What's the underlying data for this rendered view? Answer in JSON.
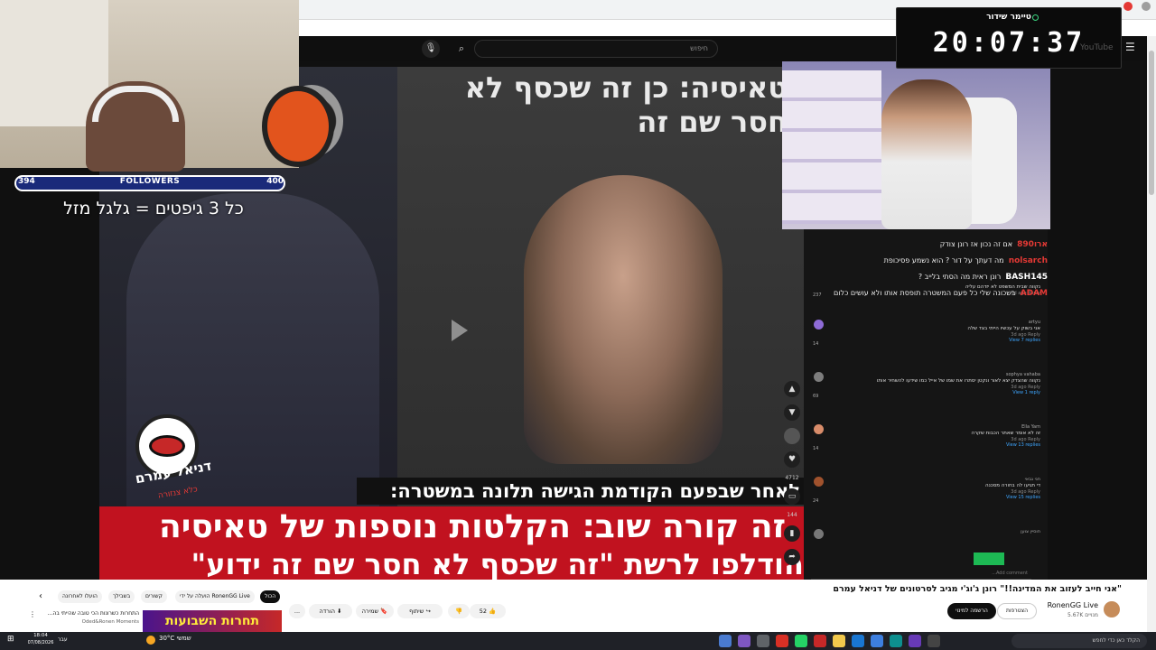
{
  "browser": {
    "search_placeholder": "חיפוש"
  },
  "timer": {
    "label": "טיימר שידור",
    "value": "20:07:37",
    "watermark": "YouTube"
  },
  "webcam": {
    "followers_label": "FOLLOWERS",
    "followers_current": "394",
    "followers_goal": "400",
    "gift_text": "כל 3 גיפטים = גלגל מזל"
  },
  "video": {
    "head_text": "טאיסיה: כן זה שכסף לא\nחסר שם זה",
    "logo_name": "דניאל עמרם",
    "logo_sub": "כלא צנזורה",
    "caption_black": "לאחר שבפעם הקודמת הגישה תלונה במשטרה:",
    "caption_red_1": "זה קורה שוב: הקלטות נוספות של טאיסיה",
    "caption_red_2": "הודלפו לרשת \"זה שכסף לא חסר שם זה ידוע\""
  },
  "chat": [
    {
      "user": "ארו890",
      "msg": "אם זה נכון אז רונן צודק",
      "color": "#e53935"
    },
    {
      "user": "nolsarch",
      "msg": "מה דעתך על דור ? הוא נשמע פסיכופת",
      "color": "#e53935"
    },
    {
      "user": "BASH145",
      "msg": "רונן ראית מה הסתי בלייב ?",
      "color": "#ffffff"
    },
    {
      "user": "ADAM",
      "msg": "בשכונה שלי כל פעם המשטרה תופסת אותו ולא עושים כלום",
      "color": "#e53935"
    }
  ],
  "comments": [
    {
      "user": "ויקטוריה",
      "text": "נקווה שבית המשפט לא יזדהם עליה",
      "meta": "4d ago",
      "reply": "Reply",
      "count": "237",
      "replies": ""
    },
    {
      "user": "artyu",
      "text": "אני בשוק על עכשיו הייתי בצד שלה",
      "meta": "3d ago",
      "reply": "Reply",
      "count": "14",
      "replies": "View 7 replies"
    },
    {
      "user": "sophya vahaba",
      "text": "נקווה שהצדק יצא לאור ונקטן יסתרו את שמו של אייל כמו שידעו להשחיר אותו",
      "meta": "3d ago",
      "reply": "Reply",
      "count": "69",
      "replies": "View 1 reply"
    },
    {
      "user": "Ella Yam",
      "text": "זה לא אומר שאתר הכבות שקרה",
      "meta": "3d ago",
      "reply": "Reply",
      "count": "14",
      "replies": "View 13 replies"
    },
    {
      "user": "חני גבאי",
      "text": "די תגיעו לה בחורה מסכנה",
      "meta": "3d ago",
      "reply": "Reply",
      "count": "24",
      "replies": "View 15 replies"
    },
    {
      "user": "חוסיין צוען",
      "text": "",
      "meta": "",
      "reply": "",
      "count": "",
      "replies": ""
    }
  ],
  "comments_input_placeholder": "Add comment...",
  "actions": {
    "likes_small": "4712",
    "comments_small": "144"
  },
  "info": {
    "title": "\"אני חייב לעזוב את המדינה!!\" רונן ג'וג'י מגיב לסרטונים של דניאל עמרם",
    "channel": "RonenGG Live",
    "subs": "5.67K מנויים",
    "join": "הצטרפות",
    "subscribe": "הרשמה למינוי",
    "likes": "52",
    "share": "שיתוף",
    "save": "שמירה",
    "download": "הורדה",
    "more": "...",
    "chips": {
      "all": "הכול",
      "ronen": "הועלה על ידי RonenGG Live",
      "related": "קשורים",
      "foryou": "בשבילך",
      "recent": "הועלו לאחרונה"
    },
    "rec_thumb_text": "תחרות השבועות",
    "rec_title": "התחרות כשרונות הכי טובה שהייתי בה...",
    "rec_channel": "Oded&Ronen Moments"
  },
  "taskbar": {
    "time": "18:04",
    "date": "07/08/2026",
    "lang": "עבר",
    "temp": "30°C",
    "weather": "שמשי",
    "search": "הקלד כאן כדי לחפש"
  }
}
